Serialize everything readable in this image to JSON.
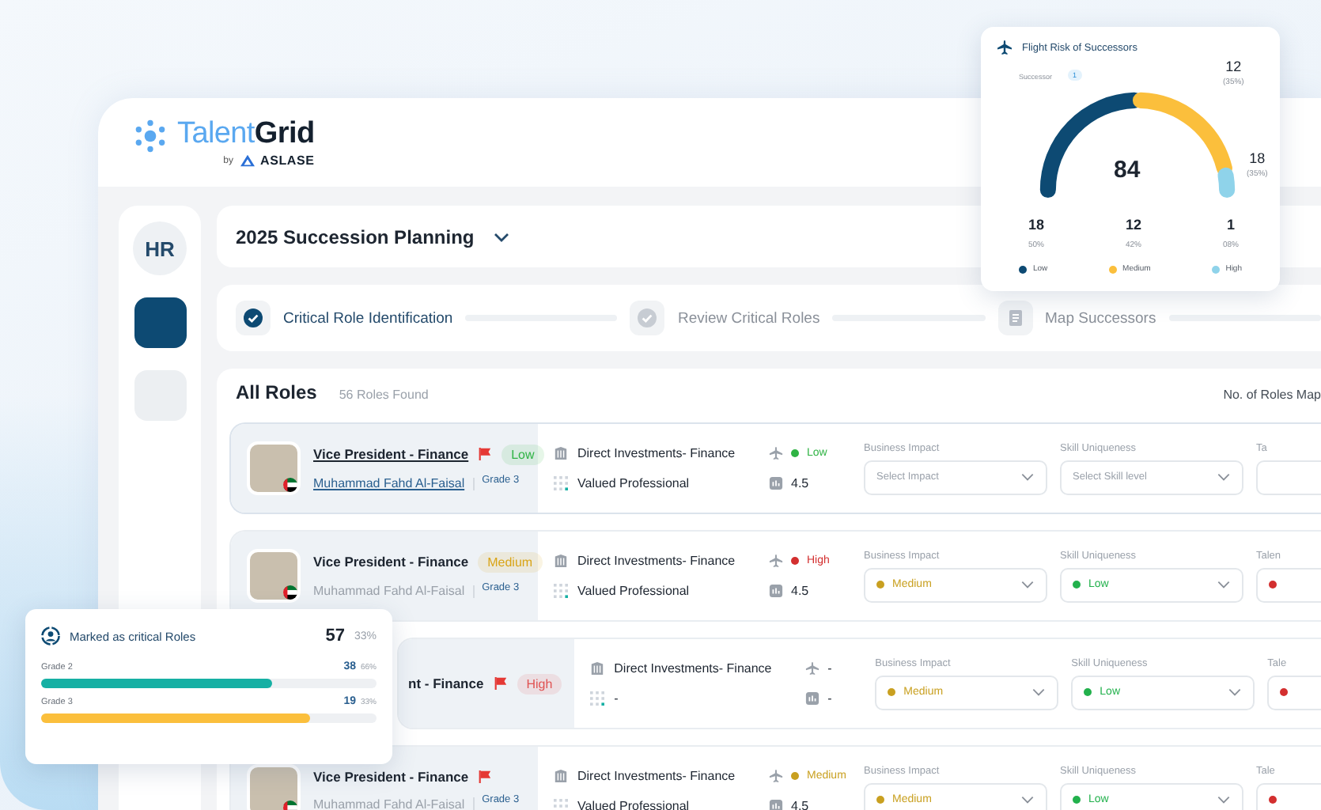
{
  "brand": {
    "first": "Talent",
    "second": "Grid",
    "by": "by",
    "company": "ASLASE"
  },
  "sidebar": {
    "items": [
      {
        "kind": "avatar",
        "text": "HR"
      },
      {
        "kind": "nav",
        "selected": true
      },
      {
        "kind": "nav",
        "selected": false
      }
    ]
  },
  "plan": {
    "title": "2025 Succession Planning"
  },
  "steps": [
    {
      "label": "Critical Role Identification",
      "selected": true,
      "kind": "check"
    },
    {
      "label": "Review Critical Roles",
      "selected": false,
      "kind": "check"
    },
    {
      "label": "Map Successors",
      "selected": false,
      "kind": "doc"
    }
  ],
  "roles": {
    "title": "All Roles",
    "count": "56 Roles Found",
    "right_label": "No. of Roles Map",
    "rows": [
      {
        "selected": true,
        "avatar": true,
        "title": "Vice President - Finance",
        "flagged": true,
        "badge": {
          "text": "Low",
          "color": "#2fb344"
        },
        "name": "Muhammad Fahd Al-Faisal",
        "grade": "Grade 3",
        "department": "Direct Investments- Finance",
        "flight_risk": {
          "text": "Low",
          "color": "#2fb344"
        },
        "category": "Valued Professional",
        "rating": "4.5",
        "business_impact": {
          "label": "Business Impact",
          "placeholder": "Select Impact"
        },
        "skill_uniqueness": {
          "label": "Skill Uniqueness",
          "placeholder": "Select Skill level"
        },
        "column_3": {
          "label": "Ta"
        }
      },
      {
        "selected": false,
        "avatar": true,
        "title": "Vice President - Finance",
        "flagged": false,
        "badge": {
          "text": "Medium",
          "color": "#d9a416"
        },
        "name": "Muhammad Fahd Al-Faisal",
        "grade": "Grade 3",
        "department": "Direct Investments- Finance",
        "flight_risk": {
          "text": "High",
          "color": "#d32f2f"
        },
        "category": "Valued Professional",
        "rating": "4.5",
        "business_impact": {
          "label": "Business Impact",
          "value": "Medium",
          "color": "#c9a020"
        },
        "skill_uniqueness": {
          "label": "Skill Uniqueness",
          "value": "Low",
          "color": "#22b14c"
        },
        "column_3": {
          "label": "Talen",
          "color": "#d32f2f"
        }
      },
      {
        "selected": false,
        "avatar": false,
        "title": "nt - Finance",
        "flagged": true,
        "badge": {
          "text": "High",
          "color": "#e05252"
        },
        "department": "Direct Investments- Finance",
        "flight_risk": {
          "text": "-"
        },
        "category": "-",
        "rating": "-",
        "business_impact": {
          "label": "Business Impact",
          "value": "Medium",
          "color": "#c9a020"
        },
        "skill_uniqueness": {
          "label": "Skill Uniqueness",
          "value": "Low",
          "color": "#22b14c"
        },
        "column_3": {
          "label": "Tale",
          "color": "#d32f2f"
        }
      },
      {
        "selected": false,
        "avatar": true,
        "title": "Vice President - Finance",
        "flagged": true,
        "name": "Muhammad Fahd Al-Faisal",
        "grade": "Grade 3",
        "department": "Direct Investments- Finance",
        "flight_risk": {
          "text": "Medium",
          "color": "#c9a020"
        },
        "category": "Valued Professional",
        "rating": "4.5",
        "business_impact": {
          "label": "Business Impact",
          "value": "Medium",
          "color": "#c9a020"
        },
        "skill_uniqueness": {
          "label": "Skill Uniqueness",
          "value": "Low",
          "color": "#22b14c"
        },
        "column_3": {
          "label": "Tale",
          "color": "#d32f2f"
        }
      }
    ]
  },
  "flight_card": {
    "title": "Flight Risk of Successors",
    "successor_label": "Successor",
    "successor_count": "1",
    "total": "84",
    "medium_value": "12",
    "medium_pct": "(35%)",
    "high_value": "18",
    "high_pct": "(35%)",
    "stats": [
      {
        "value": "18",
        "pct": "50%"
      },
      {
        "value": "12",
        "pct": "42%"
      },
      {
        "value": "1",
        "pct": "08%"
      }
    ],
    "legend": [
      {
        "label": "Low",
        "color": "#0d4a73"
      },
      {
        "label": "Medium",
        "color": "#fbbf3c"
      },
      {
        "label": "High",
        "color": "#8fd3ea"
      }
    ]
  },
  "critical_card": {
    "title": "Marked as critical Roles",
    "value": "57",
    "pct": "33%",
    "grades": [
      {
        "label": "Grade 2",
        "value": "38",
        "pct": "66%",
        "level": 0.69,
        "color": "#16b0a4"
      },
      {
        "label": "Grade 3",
        "value": "19",
        "pct": "33%",
        "level": 0.8,
        "color": "#fbbf3c"
      }
    ]
  }
}
